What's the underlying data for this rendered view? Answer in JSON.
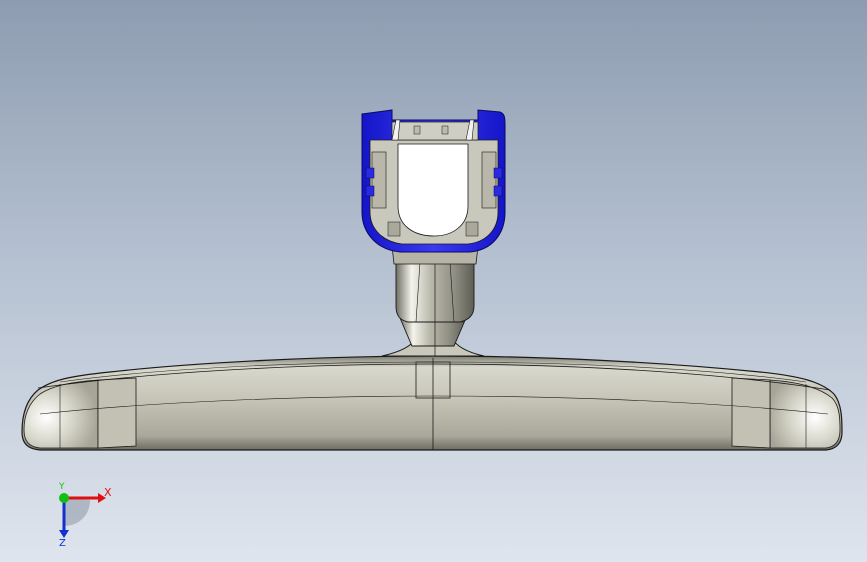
{
  "viewport": {
    "background_top": "#8e9cb1",
    "background_bottom": "#dfe5ee"
  },
  "model": {
    "body_color": "#bdbcae",
    "edge_color": "#1a1a1a",
    "section_color": "#2a2ae0",
    "cavity_color": "#ffffff"
  },
  "triad": {
    "x_label": "X",
    "y_label": "Y",
    "z_label": "Z",
    "x_color": "#e01010",
    "y_color": "#10c010",
    "z_color": "#1030d0"
  }
}
